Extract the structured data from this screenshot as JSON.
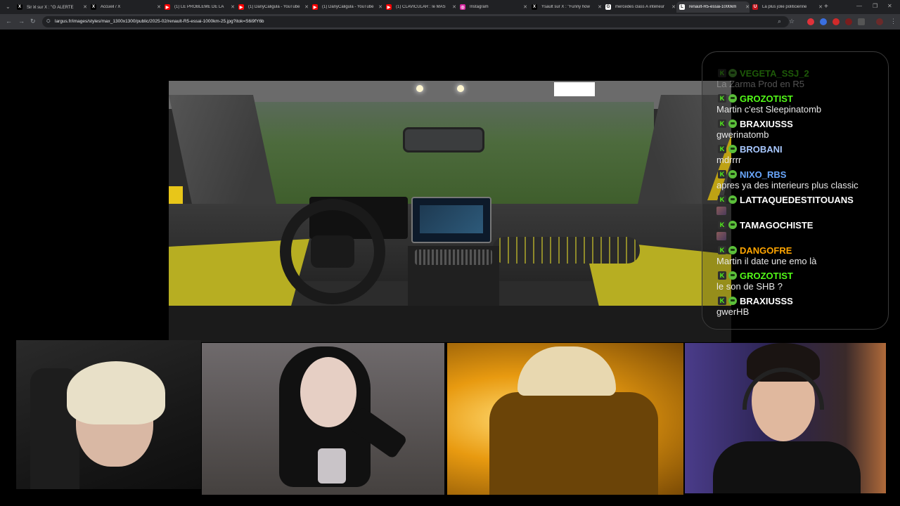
{
  "browser": {
    "tabs": [
      {
        "label": "Sir ℵ sur X : \"ⵙ ALERTE",
        "favicon": "x-icon",
        "active": false
      },
      {
        "label": "Accueil / X",
        "favicon": "x-icon",
        "active": false
      },
      {
        "label": "(1) LE PROBLÈME DE LA",
        "favicon": "youtube-icon",
        "active": false
      },
      {
        "label": "(1) DanyCaligula - YouTube",
        "favicon": "youtube-icon",
        "active": false
      },
      {
        "label": "(1) DanyCaligula - YouTube",
        "favicon": "youtube-icon",
        "active": false
      },
      {
        "label": "(1) CLAVICULAR : le MAS",
        "favicon": "youtube-icon",
        "active": false
      },
      {
        "label": "Instagram",
        "favicon": "instagram-icon",
        "active": false
      },
      {
        "label": "Ysault sur X : \"Funny how",
        "favicon": "x-icon",
        "active": false
      },
      {
        "label": "mercedes class A intérieur",
        "favicon": "google-icon",
        "active": false
      },
      {
        "label": "renault-R5-essai-1000km",
        "favicon": "largus-icon",
        "active": true
      },
      {
        "label": "La plus jolie politicienne",
        "favicon": "u-icon",
        "active": false
      }
    ],
    "url": "largus.fr/images/styles/max_1300x1300/public/2025-02/renault-R5-essai-1000km-25.jpg?itok=S6i9fY6b"
  },
  "chat": {
    "messages": [
      {
        "user": "VEGETA_SSJ_2",
        "color": "#53fc18",
        "text": "La Zarma Prod en R5",
        "emote_only": false
      },
      {
        "user": "GROZOTIST",
        "color": "#53fc18",
        "text": "Martin c'est Sleepinatomb",
        "emote_only": false
      },
      {
        "user": "BRAXIUSSS",
        "color": "#ffffff",
        "text": "gwerinatomb",
        "emote_only": false
      },
      {
        "user": "BROBANI",
        "color": "#a8c8ff",
        "text": "mdrrrr",
        "emote_only": false
      },
      {
        "user": "NIXO_RBS",
        "color": "#6aa8ff",
        "text": "apres ya des interieurs plus classic",
        "emote_only": false
      },
      {
        "user": "LATTAQUEDESTITOUANS",
        "color": "#ffffff",
        "text": "",
        "emote_only": true
      },
      {
        "user": "TAMAGOCHISTE",
        "color": "#ffffff",
        "text": "",
        "emote_only": true
      },
      {
        "user": "DANGOFRE",
        "color": "#ffa500",
        "text": "Martin il date une emo là",
        "emote_only": false
      },
      {
        "user": "GROZOTIST",
        "color": "#53fc18",
        "text": "le son de SHB ?",
        "emote_only": false
      },
      {
        "user": "BRAXIUSSS",
        "color": "#ffffff",
        "text": "gwerHB",
        "emote_only": false
      }
    ],
    "badge_letter": "K"
  },
  "colors": {
    "kick_green": "#53fc18",
    "tabbar_bg": "#202124",
    "toolbar_bg": "#35363a"
  }
}
